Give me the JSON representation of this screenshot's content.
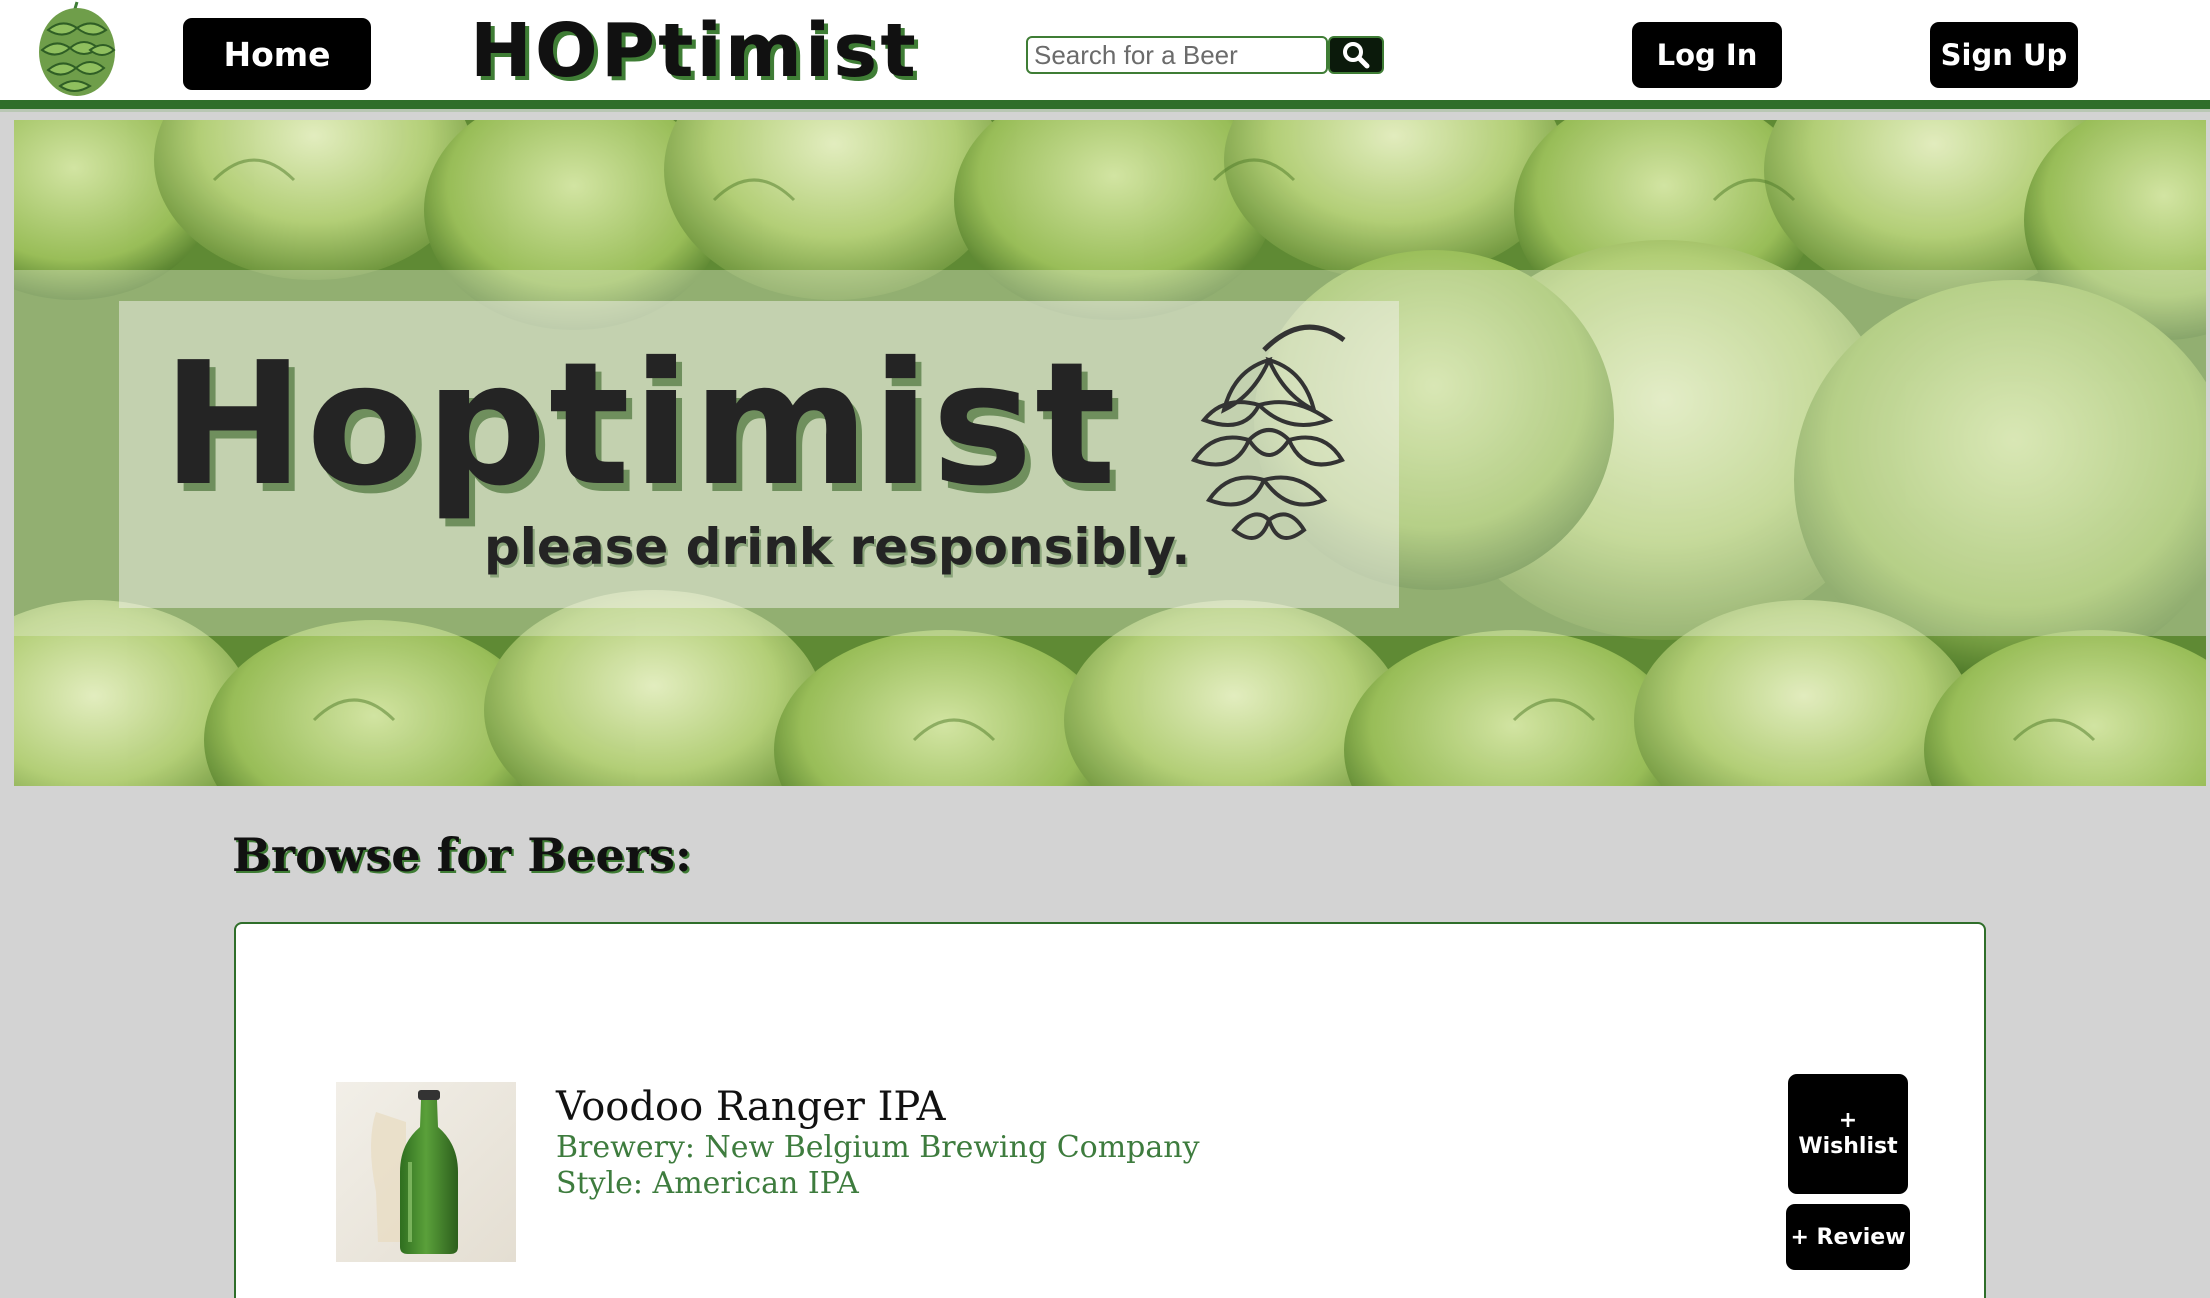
{
  "navbar": {
    "logo_icon": "hop-cone-icon",
    "home_label": "Home",
    "brand": "HOPtimist",
    "search": {
      "placeholder": "Search for a Beer",
      "value": "",
      "button_icon": "search-icon"
    },
    "login_label": "Log In",
    "signup_label": "Sign Up"
  },
  "hero": {
    "title": "Hoptimist",
    "tagline": "please drink responsibly.",
    "hop_icon": "hop-cone-drawing-icon"
  },
  "browse": {
    "heading": "Browse for Beers:",
    "beers": [
      {
        "name": "Voodoo Ranger IPA",
        "brewery": "Brewery: New Belgium Brewing Company",
        "style": "Style: American IPA",
        "wishlist_plus": "+",
        "wishlist_label": "Wishlist",
        "review_label": "+ Review"
      }
    ]
  },
  "colors": {
    "accent_green": "#2f6e2a",
    "text_green": "#3e7c3e",
    "button_black": "#000000",
    "page_bg": "#d3d3d3"
  }
}
